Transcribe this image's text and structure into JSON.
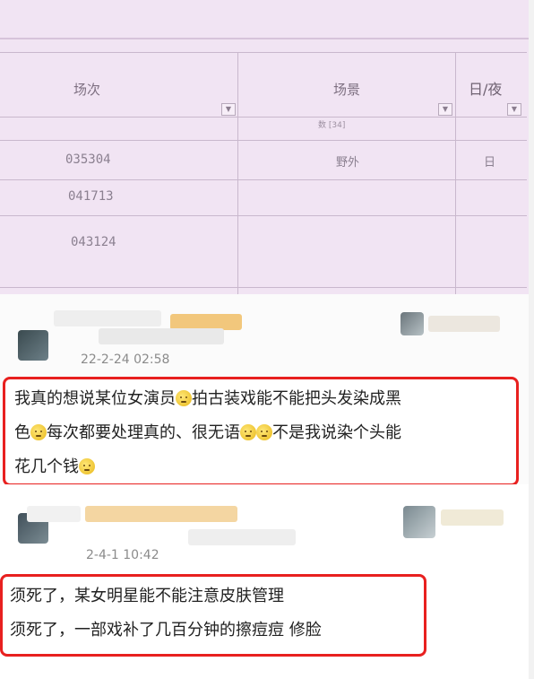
{
  "table": {
    "headers": [
      "场次",
      "场景",
      "日/夜"
    ],
    "sub_header": "数 [34]",
    "rows": [
      {
        "scene": "035304",
        "place": "野外",
        "daynight": "日"
      },
      {
        "scene": "041713",
        "place": "",
        "daynight": ""
      },
      {
        "scene": "043124",
        "place": "",
        "daynight": ""
      }
    ]
  },
  "comments": [
    {
      "timestamp": "22-2-24 02:58",
      "text_lines": [
        [
          "我真的想说某位女演员",
          "emoji",
          "拍古装戏能不能把头发染成黑"
        ],
        [
          "色",
          "emoji",
          "每次都要处理真的、很无语",
          "emoji",
          "emoji",
          "不是我说染个头能"
        ],
        [
          "花几个钱",
          "emoji"
        ]
      ]
    },
    {
      "timestamp": "2-4-1 10:42",
      "text_lines": [
        [
          "须死了，某女明星能不能注意皮肤管理"
        ],
        [
          "须死了，一部戏补了几百分钟的擦痘痘 修脸"
        ]
      ]
    }
  ],
  "colors": {
    "highlight": "#e8201f",
    "table_bg": "#f1e4f3"
  }
}
